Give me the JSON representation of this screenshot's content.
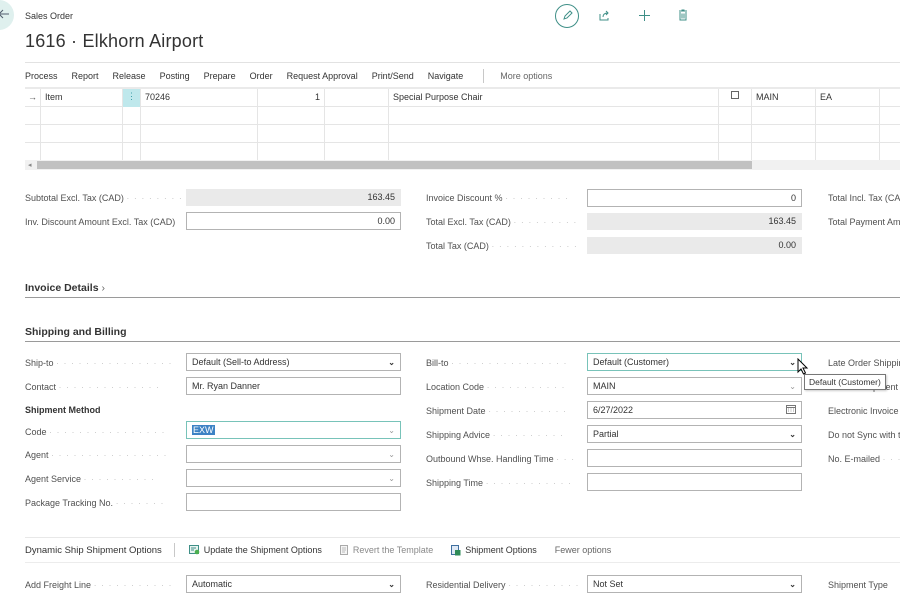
{
  "header": {
    "page_type": "Sales Order",
    "title": "1616 · Elkhorn Airport",
    "back_icon": "arrow-left",
    "top_actions": [
      {
        "name": "edit",
        "icon": "pencil"
      },
      {
        "name": "share",
        "icon": "share"
      },
      {
        "name": "new",
        "icon": "plus"
      },
      {
        "name": "delete",
        "icon": "trash"
      }
    ]
  },
  "action_bar": {
    "items": [
      "Process",
      "Report",
      "Release",
      "Posting",
      "Prepare",
      "Order",
      "Request Approval",
      "Print/Send",
      "Navigate"
    ],
    "more_options": "More options"
  },
  "lines": {
    "rows": [
      {
        "marker": "→",
        "type": "Item",
        "no": "70246",
        "quantity": "1",
        "description": "Special Purpose Chair",
        "checkbox": false,
        "location": "MAIN",
        "uom": "EA"
      },
      {
        "marker": "",
        "type": "",
        "no": "",
        "quantity": "",
        "description": "",
        "checkbox": null,
        "location": "",
        "uom": ""
      },
      {
        "marker": "",
        "type": "",
        "no": "",
        "quantity": "",
        "description": "",
        "checkbox": null,
        "location": "",
        "uom": ""
      },
      {
        "marker": "",
        "type": "",
        "no": "",
        "quantity": "",
        "description": "",
        "checkbox": null,
        "location": "",
        "uom": ""
      }
    ],
    "dots_glyph": "⋮"
  },
  "totals": {
    "subtotal_label": "Subtotal Excl. Tax (CAD)",
    "subtotal_value": "163.45",
    "inv_discount_amount_label": "Inv. Discount Amount Excl. Tax (CAD)",
    "inv_discount_amount_value": "0.00",
    "invoice_discount_pct_label": "Invoice Discount %",
    "invoice_discount_pct_value": "0",
    "total_excl_label": "Total Excl. Tax (CAD)",
    "total_excl_value": "163.45",
    "total_tax_label": "Total Tax (CAD)",
    "total_tax_value": "0.00",
    "total_incl_label": "Total Incl. Tax (CAD)",
    "total_payment_label": "Total Payment Amount"
  },
  "sections": {
    "invoice_details": "Invoice Details",
    "shipping_billing": "Shipping and Billing"
  },
  "shipping": {
    "ship_to_label": "Ship-to",
    "ship_to_value": "Default (Sell-to Address)",
    "contact_label": "Contact",
    "contact_value": "Mr. Ryan Danner",
    "shipment_method_heading": "Shipment Method",
    "code_label": "Code",
    "code_value": "EXW",
    "agent_label": "Agent",
    "agent_value": "",
    "agent_service_label": "Agent Service",
    "agent_service_value": "",
    "package_tracking_label": "Package Tracking No.",
    "package_tracking_value": "",
    "bill_to_label": "Bill-to",
    "bill_to_value": "Default (Customer)",
    "location_code_label": "Location Code",
    "location_code_value": "MAIN",
    "shipment_date_label": "Shipment Date",
    "shipment_date_value": "6/27/2022",
    "shipping_advice_label": "Shipping Advice",
    "shipping_advice_value": "Partial",
    "outbound_whse_label": "Outbound Whse. Handling Time",
    "outbound_whse_value": "",
    "shipping_time_label": "Shipping Time",
    "shipping_time_value": "",
    "late_order_label": "Late Order Shipping",
    "shipment_label_partial": "Shipment",
    "electronic_invoice_label": "Electronic Invoice T",
    "do_not_sync_label": "Do not Sync with th",
    "no_emailed_label": "No. E-mailed",
    "tooltip": "Default (Customer)"
  },
  "dynamic_ship": {
    "title": "Dynamic Ship Shipment Options",
    "buttons": [
      {
        "label": "Update the Shipment Options",
        "icon": "update-shipment"
      },
      {
        "label": "Revert the Template",
        "icon": "revert-template",
        "disabled": true
      },
      {
        "label": "Shipment Options",
        "icon": "shipment-options"
      }
    ],
    "fewer_options": "Fewer options",
    "add_freight_label": "Add Freight Line",
    "add_freight_value": "Automatic",
    "residential_label": "Residential Delivery",
    "residential_value": "Not Set",
    "shipment_type_label": "Shipment Type"
  },
  "colors": {
    "accent": "#3f8f87",
    "focus_border": "#78c3b9",
    "selected_cell": "#bfe8ec",
    "readonly_bg": "#eaeaea"
  }
}
